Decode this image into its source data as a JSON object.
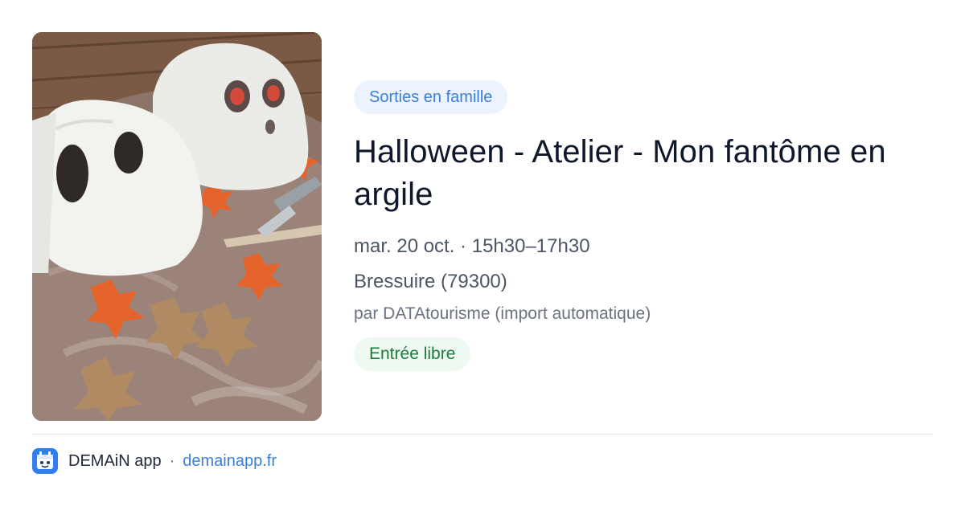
{
  "event": {
    "image_alt": "Fantômes en argile blanche sur une table avec des feuilles d'automne découpées",
    "category": "Sorties en famille",
    "title": "Halloween - Atelier - Mon fantôme en argile",
    "date_time": "mar. 20 oct. · 15h30–17h30",
    "location": "Bressuire (79300)",
    "source": "par DATAtourisme (import automatique)",
    "price": "Entrée libre"
  },
  "footer": {
    "app_icon": "calendar-icon",
    "app_name": "DEMAiN app",
    "separator": "·",
    "domain": "demainapp.fr"
  },
  "colors": {
    "category_chip_bg": "#ecf3fd",
    "category_chip_text": "#3a7fd8",
    "price_chip_bg": "#eefaf1",
    "price_chip_text": "#1f7a3a",
    "link": "#3a7fd8",
    "app_icon_bg": "#2f80ed"
  }
}
